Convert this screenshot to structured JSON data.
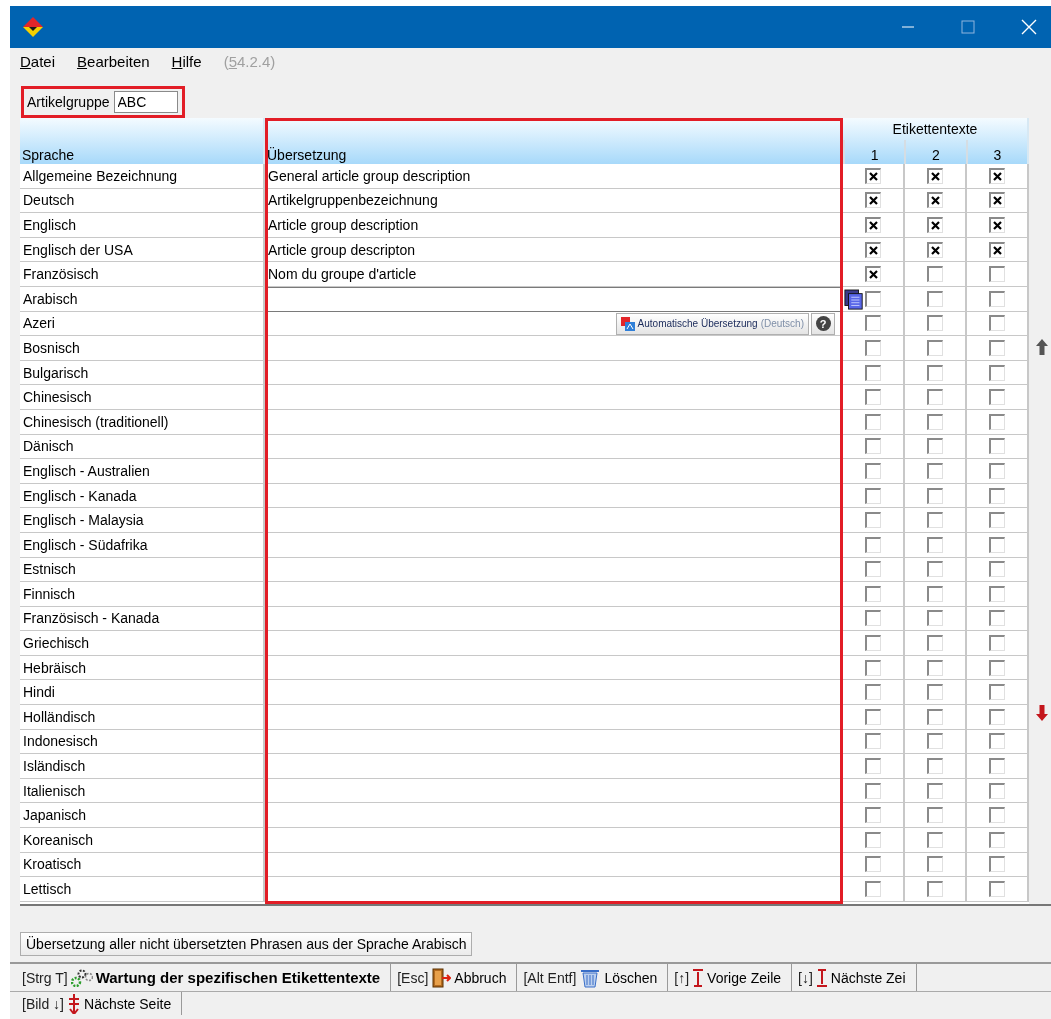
{
  "menu": [
    {
      "label": "Datei",
      "disabled": false
    },
    {
      "label": "Bearbeiten",
      "disabled": false
    },
    {
      "label": "Hilfe",
      "disabled": false
    },
    {
      "label": "(54.2.4)",
      "disabled": true
    }
  ],
  "filter": {
    "label": "Artikelgruppe",
    "value": "ABC",
    "highlighted": true
  },
  "table": {
    "group_header": "Etikettentexte",
    "columns": [
      {
        "label": "Sprache",
        "highlighted": false
      },
      {
        "label": "Übersetzung",
        "highlighted": true
      },
      {
        "label": "1"
      },
      {
        "label": "2"
      },
      {
        "label": "3"
      }
    ],
    "rows": [
      {
        "language": "Allgemeine Bezeichnung",
        "translation": "General article group description",
        "editing": false,
        "checks": [
          true,
          true,
          true
        ]
      },
      {
        "language": "Deutsch",
        "translation": "Artikelgruppenbezeichnung",
        "editing": false,
        "checks": [
          true,
          true,
          true
        ]
      },
      {
        "language": "Englisch",
        "translation": "Article group description",
        "editing": false,
        "checks": [
          true,
          true,
          true
        ]
      },
      {
        "language": "Englisch der USA",
        "translation": "Article group descripton",
        "editing": false,
        "checks": [
          true,
          true,
          true
        ]
      },
      {
        "language": "Französisch",
        "translation": "Nom du groupe d'article",
        "editing": false,
        "checks": [
          true,
          false,
          false
        ]
      },
      {
        "language": "Arabisch",
        "translation": "",
        "editing": true,
        "checks": [
          false,
          false,
          false
        ]
      },
      {
        "language": "Azeri",
        "translation": "",
        "editing": false,
        "checks": [
          false,
          false,
          false
        ]
      },
      {
        "language": "Bosnisch",
        "translation": "",
        "editing": false,
        "checks": [
          false,
          false,
          false
        ]
      },
      {
        "language": "Bulgarisch",
        "translation": "",
        "editing": false,
        "checks": [
          false,
          false,
          false
        ]
      },
      {
        "language": "Chinesisch",
        "translation": "",
        "editing": false,
        "checks": [
          false,
          false,
          false
        ]
      },
      {
        "language": "Chinesisch (traditionell)",
        "translation": "",
        "editing": false,
        "checks": [
          false,
          false,
          false
        ]
      },
      {
        "language": "Dänisch",
        "translation": "",
        "editing": false,
        "checks": [
          false,
          false,
          false
        ]
      },
      {
        "language": "Englisch - Australien",
        "translation": "",
        "editing": false,
        "checks": [
          false,
          false,
          false
        ]
      },
      {
        "language": "Englisch - Kanada",
        "translation": "",
        "editing": false,
        "checks": [
          false,
          false,
          false
        ]
      },
      {
        "language": "Englisch - Malaysia",
        "translation": "",
        "editing": false,
        "checks": [
          false,
          false,
          false
        ]
      },
      {
        "language": "Englisch - Südafrika",
        "translation": "",
        "editing": false,
        "checks": [
          false,
          false,
          false
        ]
      },
      {
        "language": "Estnisch",
        "translation": "",
        "editing": false,
        "checks": [
          false,
          false,
          false
        ]
      },
      {
        "language": "Finnisch",
        "translation": "",
        "editing": false,
        "checks": [
          false,
          false,
          false
        ]
      },
      {
        "language": "Französisch - Kanada",
        "translation": "",
        "editing": false,
        "checks": [
          false,
          false,
          false
        ]
      },
      {
        "language": "Griechisch",
        "translation": "",
        "editing": false,
        "checks": [
          false,
          false,
          false
        ]
      },
      {
        "language": "Hebräisch",
        "translation": "",
        "editing": false,
        "checks": [
          false,
          false,
          false
        ]
      },
      {
        "language": "Hindi",
        "translation": "",
        "editing": false,
        "checks": [
          false,
          false,
          false
        ]
      },
      {
        "language": "Holländisch",
        "translation": "",
        "editing": false,
        "checks": [
          false,
          false,
          false
        ]
      },
      {
        "language": "Indonesisch",
        "translation": "",
        "editing": false,
        "checks": [
          false,
          false,
          false
        ]
      },
      {
        "language": "Isländisch",
        "translation": "",
        "editing": false,
        "checks": [
          false,
          false,
          false
        ]
      },
      {
        "language": "Italienisch",
        "translation": "",
        "editing": false,
        "checks": [
          false,
          false,
          false
        ]
      },
      {
        "language": "Japanisch",
        "translation": "",
        "editing": false,
        "checks": [
          false,
          false,
          false
        ]
      },
      {
        "language": "Koreanisch",
        "translation": "",
        "editing": false,
        "checks": [
          false,
          false,
          false
        ]
      },
      {
        "language": "Kroatisch",
        "translation": "",
        "editing": false,
        "checks": [
          false,
          false,
          false
        ]
      },
      {
        "language": "Lettisch",
        "translation": "",
        "editing": false,
        "checks": [
          false,
          false,
          false
        ]
      }
    ],
    "translate_popup": {
      "label": "Automatische Übersetzung",
      "source": "(Deutsch)",
      "help": "?"
    }
  },
  "translate_all_button": "Übersetzung aller nicht übersetzten Phrasen aus der Sprache Arabisch",
  "toolbar": [
    {
      "kind": "title",
      "key": "[Strg T]",
      "label": "Wartung der spezifischen Etikettentexte"
    },
    {
      "kind": "exit",
      "key": "[Esc]",
      "label": "Abbruch"
    },
    {
      "kind": "delete",
      "key": "[Alt Entf]",
      "label": "Löschen"
    },
    {
      "kind": "prev",
      "key": "[↑]",
      "label": "Vorige Zeile"
    },
    {
      "kind": "next",
      "key": "[↓]",
      "label": "Nächste Zei"
    }
  ],
  "toolbar_row2": [
    {
      "kind": "page",
      "key": "[Bild ↓]",
      "label": "Nächste Seite"
    }
  ]
}
